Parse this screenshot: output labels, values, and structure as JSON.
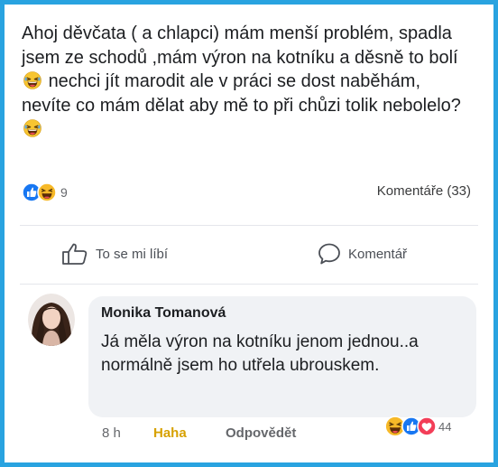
{
  "post": {
    "text": "Ahoj děvčata ( a chlapci) mám menší problém, spadla jsem ze schodů ,mám výron na kotníku a děsně to bolí",
    "text_after_emoji": "nechci jít marodit ale v práci se dost naběhám, nevíte co mám dělat aby mě to při chůzi tolik nebolelo?",
    "reaction_count": "9",
    "comments_count": "Komentáře (33)"
  },
  "actions": {
    "like_label": "To se mi líbí",
    "comment_label": "Komentář"
  },
  "comment": {
    "author": "Monika Tomanová",
    "text": "Já měla výron na kotníku jenom jednou..a normálně jsem ho utřela ubrouskem.",
    "time": "8 h",
    "reaction_button": "Haha",
    "reply_label": "Odpovědět",
    "reaction_count": "44"
  },
  "colors": {
    "frame": "#29a3e0",
    "like_blue": "#1877f2",
    "haha_yellow": "#f7b928",
    "love_red": "#f33e58"
  },
  "icons": [
    "laughing-emoji-icon",
    "like-reaction-icon",
    "haha-reaction-icon",
    "love-reaction-icon",
    "thumbs-up-icon",
    "comment-bubble-icon",
    "avatar"
  ]
}
